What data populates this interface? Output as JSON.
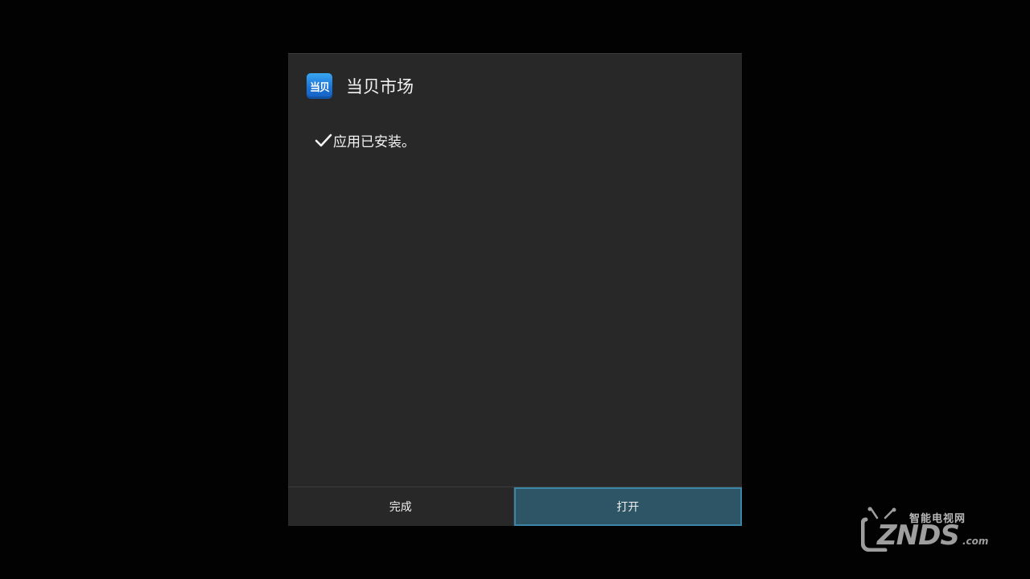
{
  "dialog": {
    "app_icon_text": "当贝",
    "app_title": "当贝市场",
    "message": "应用已安装。",
    "buttons": {
      "done_label": "完成",
      "open_label": "打开"
    }
  },
  "watermark": {
    "top_text": "智能电视网",
    "brand": "ZNDS",
    "suffix": ".com"
  },
  "colors": {
    "background": "#020202",
    "dialog_bg": "#282828",
    "focused_button_bg": "#2d5566",
    "focused_button_border": "#3b86a6",
    "app_icon_blue": "#1a73d9"
  }
}
